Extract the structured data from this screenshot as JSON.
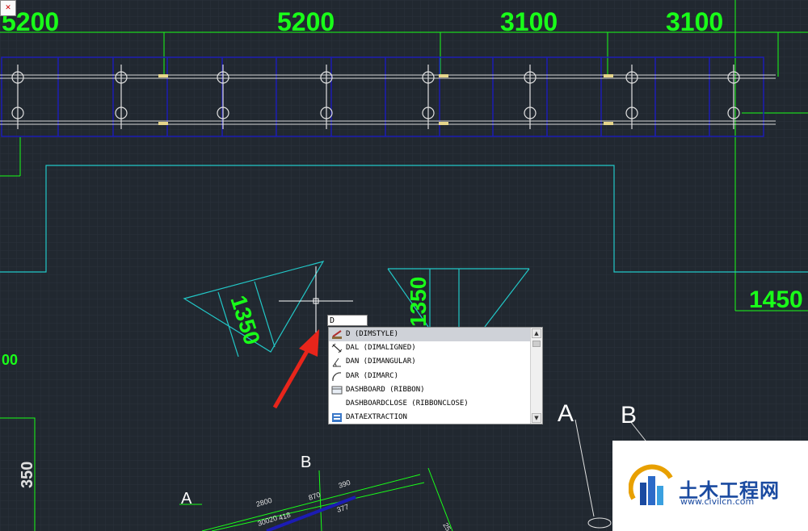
{
  "window": {
    "close_tab_glyph": "✕"
  },
  "dimensions": {
    "top_left": "5200",
    "top_mid": "5200",
    "top_r1": "3100",
    "top_r2": "3100",
    "right_side": "1450",
    "rot_left": "1350",
    "rot_mid": "1350",
    "left_edge_partial": "00",
    "left_vertical": "350"
  },
  "section_labels": {
    "a_left": "A",
    "b_left": "B",
    "a_right": "A",
    "b_right": "B"
  },
  "small_dims": [
    "2800",
    "30020",
    "418",
    "870",
    "390",
    "377",
    "25"
  ],
  "command": {
    "input_value": "D"
  },
  "autocomplete": {
    "items": [
      {
        "label": "D (DIMSTYLE)",
        "icon": "dimstyle-icon",
        "selected": true
      },
      {
        "label": "DAL (DIMALIGNED)",
        "icon": "dimaligned-icon",
        "selected": false
      },
      {
        "label": "DAN (DIMANGULAR)",
        "icon": "dimangular-icon",
        "selected": false
      },
      {
        "label": "DAR (DIMARC)",
        "icon": "dimarc-icon",
        "selected": false
      },
      {
        "label": "DASHBOARD (RIBBON)",
        "icon": "ribbon-icon",
        "selected": false
      },
      {
        "label": "DASHBOARDCLOSE (RIBBONCLOSE)",
        "icon": "",
        "selected": false
      },
      {
        "label": "DATAEXTRACTION",
        "icon": "dataextraction-icon",
        "selected": false
      }
    ]
  },
  "watermark": {
    "name": "土木工程网",
    "url": "www.civilcn.com"
  },
  "colors": {
    "background": "#212830",
    "dimension": "#19ff19",
    "outline": "#22c8c8",
    "frame": "#1c1cb4",
    "arrow": "#e8251b"
  }
}
